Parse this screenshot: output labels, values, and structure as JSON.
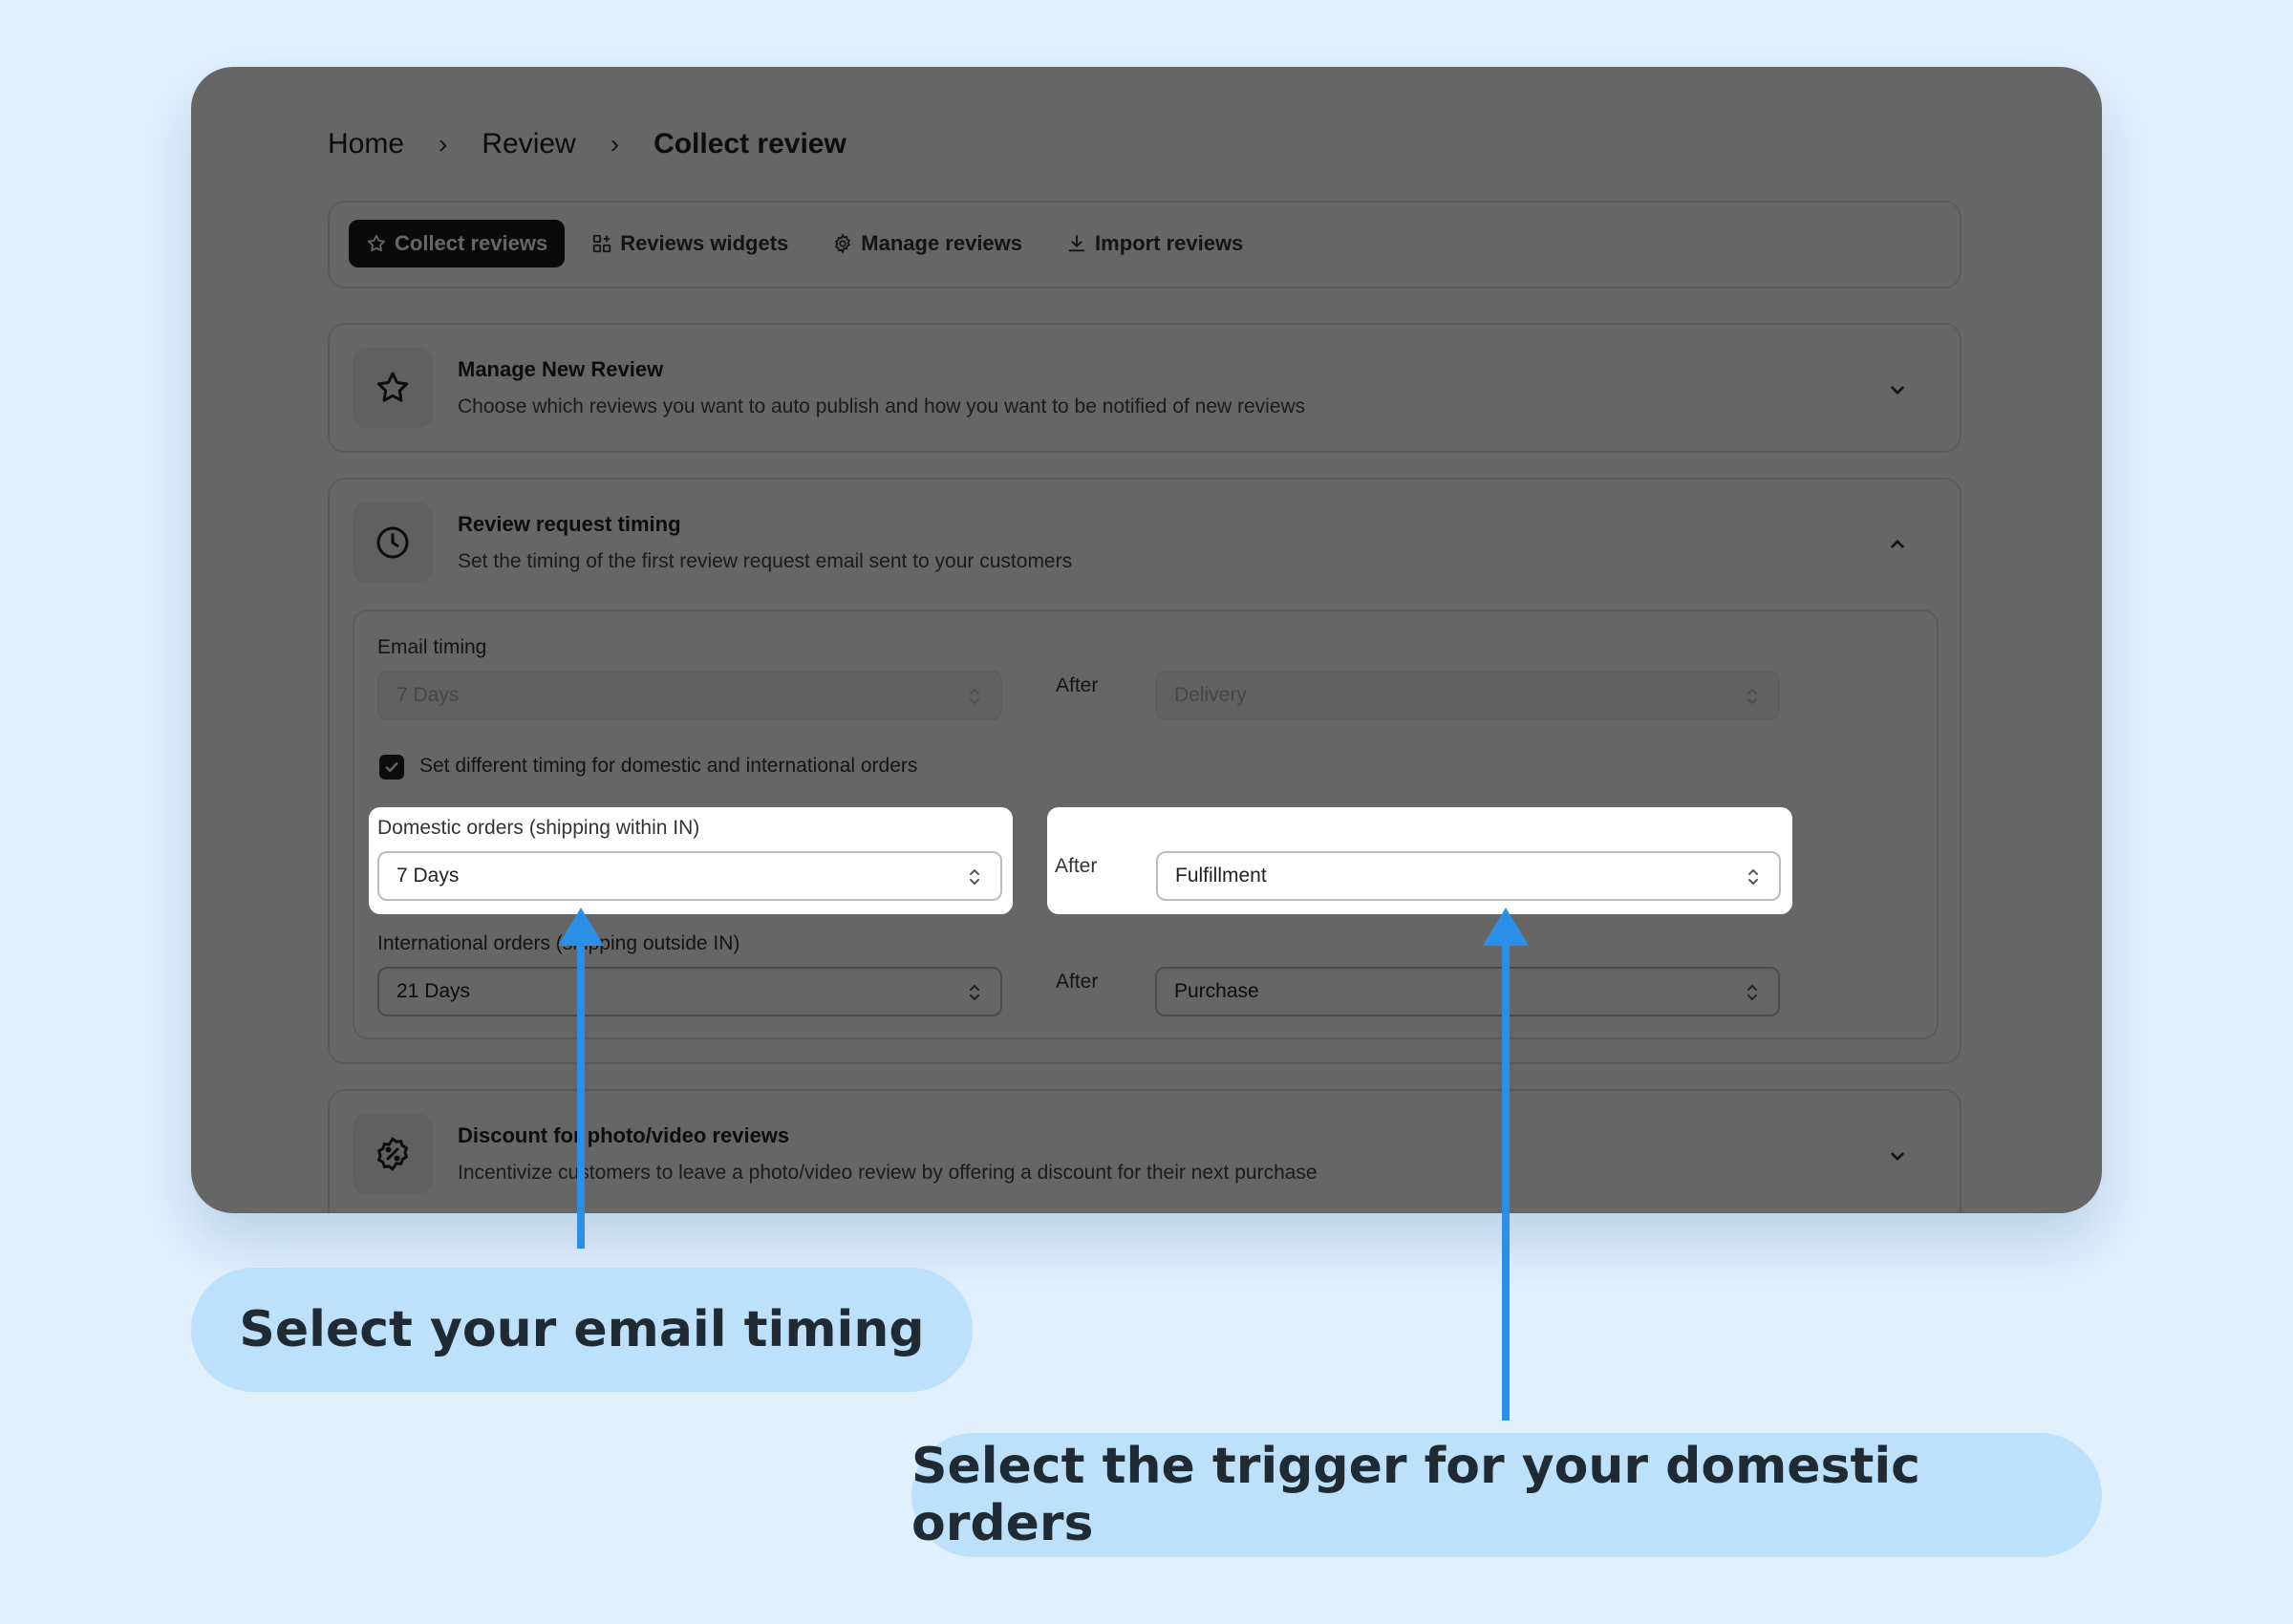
{
  "breadcrumb": {
    "home": "Home",
    "review": "Review",
    "current": "Collect review",
    "sep": "›"
  },
  "tabs": [
    {
      "label": "Collect reviews",
      "icon": "star-icon",
      "active": true
    },
    {
      "label": "Reviews widgets",
      "icon": "widgets-icon"
    },
    {
      "label": "Manage reviews",
      "icon": "gear-icon"
    },
    {
      "label": "Import reviews",
      "icon": "download-icon"
    }
  ],
  "manage_new_review": {
    "title": "Manage New Review",
    "subtitle": "Choose which reviews you want to auto publish and how you want to be notified of new reviews"
  },
  "review_request_timing": {
    "title": "Review request timing",
    "subtitle": "Set the timing of the first review request email sent to your customers",
    "email_timing": {
      "label": "Email timing",
      "days": "7 Days",
      "after_label": "After",
      "event": "Delivery"
    },
    "different_timing_checkbox": {
      "label": "Set different timing for domestic and international orders",
      "checked": true
    },
    "domestic": {
      "label": "Domestic orders (shipping within IN)",
      "days": "7 Days",
      "after_label": "After",
      "event": "Fulfillment"
    },
    "international": {
      "label": "International orders (shipping outside IN)",
      "days": "21 Days",
      "after_label": "After",
      "event": "Purchase"
    }
  },
  "discount": {
    "title": "Discount for photo/video reviews",
    "subtitle": "Incentivize customers to leave a photo/video review by offering a discount for their next purchase"
  },
  "callouts": {
    "email_timing": "Select your email timing",
    "domestic_trigger": "Select the trigger for your domestic orders"
  },
  "colors": {
    "background": "#e1f0fd",
    "callout": "#bde0fb",
    "arrow": "#2a8fe6",
    "overlay": "rgba(0,0,0,0.6)"
  }
}
